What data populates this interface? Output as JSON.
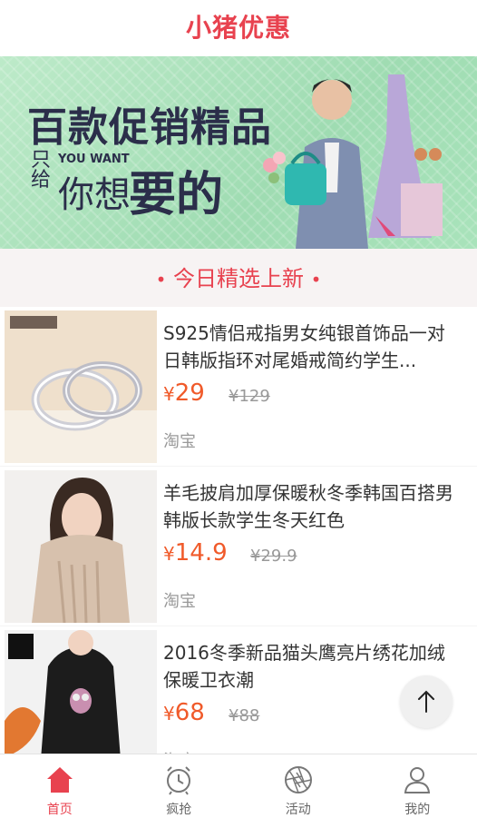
{
  "header": {
    "title": "小猪优惠"
  },
  "banner": {
    "line1": "百款促销精品",
    "only": "只给",
    "you_want": "YOU WANT",
    "line2a": "你想",
    "line2b": "要的"
  },
  "section": {
    "title": "今日精选上新",
    "dot": "•"
  },
  "products": [
    {
      "title": "S925情侣戒指男女纯银首饰品一对日韩版指环对尾婚戒简约学生...",
      "currency": "¥",
      "price": "29",
      "old_price": "¥129",
      "source": "淘宝"
    },
    {
      "title": "羊毛披肩加厚保暖秋冬季韩国百搭男韩版长款学生冬天红色",
      "currency": "¥",
      "price": "14.9",
      "old_price": "¥29.9",
      "source": "淘宝"
    },
    {
      "title": "2016冬季新品猫头鹰亮片绣花加绒保暖卫衣潮",
      "currency": "¥",
      "price": "68",
      "old_price": "¥88",
      "source": "淘宝"
    }
  ],
  "tabbar": [
    {
      "label": "首页",
      "icon": "home-icon",
      "active": true
    },
    {
      "label": "疯抢",
      "icon": "alarm-clock-icon",
      "active": false
    },
    {
      "label": "活动",
      "icon": "aperture-icon",
      "active": false
    },
    {
      "label": "我的",
      "icon": "user-icon",
      "active": false
    }
  ],
  "colors": {
    "accent": "#e8424f",
    "price": "#f05a2a",
    "banner_bg": "#a9e3bb"
  },
  "icons": {
    "back_to_top": "arrow-up-icon"
  }
}
